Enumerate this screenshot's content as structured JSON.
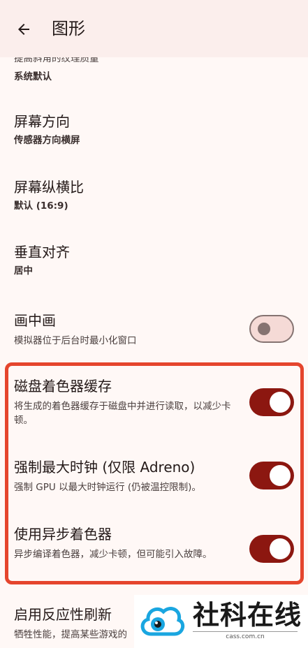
{
  "appbar": {
    "title": "图形"
  },
  "settings": {
    "texture": {
      "desc": "提高斜角的纹理质量",
      "value": "系统默认"
    },
    "orientation": {
      "label": "屏幕方向",
      "value": "传感器方向横屏"
    },
    "aspect": {
      "label": "屏幕纵横比",
      "value": "默认 (16:9)"
    },
    "valign": {
      "label": "垂直对齐",
      "value": "居中"
    },
    "pip": {
      "label": "画中画",
      "desc": "模拟器位于后台时最小化窗口",
      "enabled": false
    },
    "shader_cache": {
      "label": "磁盘着色器缓存",
      "desc": "将生成的着色器缓存于磁盘中并进行读取，以减少卡顿。",
      "enabled": true
    },
    "max_clock": {
      "label": "强制最大时钟 (仅限 Adreno)",
      "desc": "强制 GPU 以最大时钟运行 (仍被温控限制)。",
      "enabled": true
    },
    "async_shader": {
      "label": "使用异步着色器",
      "desc": "异步编译着色器，减少卡顿，但可能引入故障。",
      "enabled": true
    },
    "reactive": {
      "label": "启用反应性刷新",
      "desc": "牺牲性能，提高某些游戏的"
    }
  },
  "watermark": {
    "name": "社科在线",
    "url": "cass.com.cn"
  },
  "colors": {
    "accent": "#8c1710",
    "highlight_border": "#e5452d",
    "appbar_bg": "#fbeeec"
  }
}
